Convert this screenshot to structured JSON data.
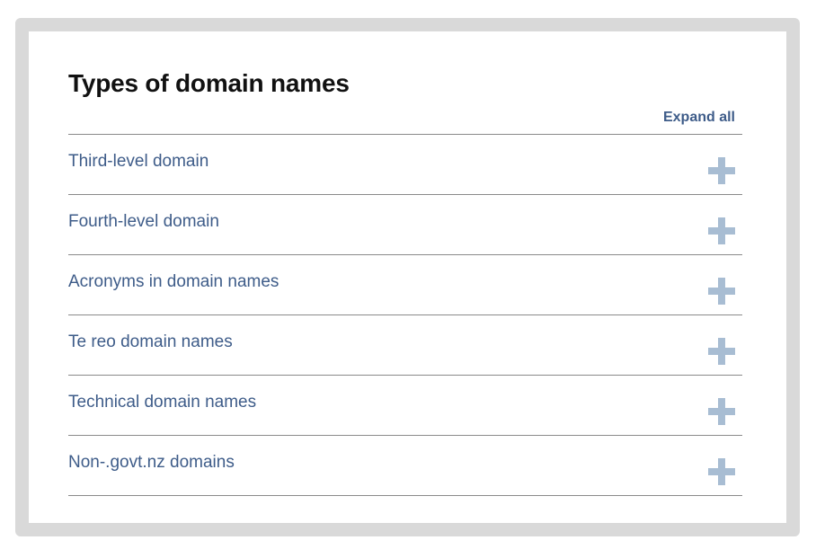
{
  "panel": {
    "title": "Types of domain names",
    "expand_all_label": "Expand all"
  },
  "accordion": {
    "items": [
      {
        "label": "Third-level domain",
        "icon": "plus-icon"
      },
      {
        "label": "Fourth-level domain",
        "icon": "plus-icon"
      },
      {
        "label": "Acronyms in domain names",
        "icon": "plus-icon"
      },
      {
        "label": "Te reo domain names",
        "icon": "plus-icon"
      },
      {
        "label": "Technical domain names",
        "icon": "plus-icon"
      },
      {
        "label": "Non-.govt.nz domains",
        "icon": "plus-icon"
      }
    ]
  },
  "colors": {
    "link": "#3e5c89",
    "icon": "#a8bdd3",
    "frame": "#d9d9d9",
    "title": "#111111"
  }
}
